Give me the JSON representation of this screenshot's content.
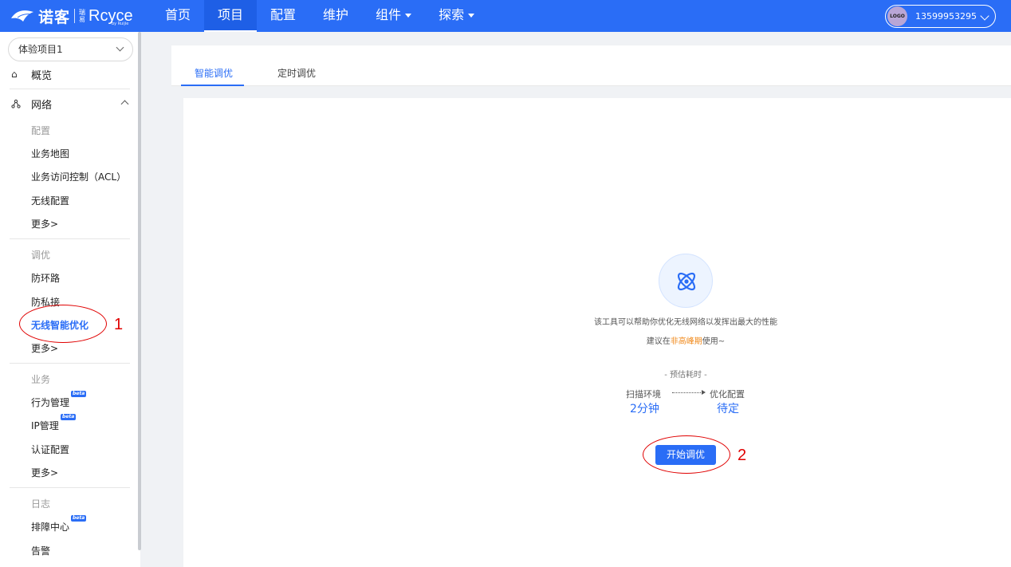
{
  "header": {
    "brand_cn": "诺客",
    "brand_sub": "瑞易",
    "brand_en": "Rcyce",
    "brand_tiny": "by Ruijie",
    "nav": [
      {
        "label": "首页",
        "active": false,
        "dropdown": false
      },
      {
        "label": "项目",
        "active": true,
        "dropdown": false
      },
      {
        "label": "配置",
        "active": false,
        "dropdown": false
      },
      {
        "label": "维护",
        "active": false,
        "dropdown": false
      },
      {
        "label": "组件",
        "active": false,
        "dropdown": true
      },
      {
        "label": "探索",
        "active": false,
        "dropdown": true
      }
    ],
    "user": {
      "logo_text": "LOGO",
      "phone": "13599953295"
    }
  },
  "sidebar": {
    "project": "体验项目1",
    "overview": "概览",
    "network": "网络",
    "groups": [
      {
        "title": "配置",
        "items": [
          "业务地图",
          "业务访问控制（ACL）",
          "无线配置",
          "更多>"
        ]
      },
      {
        "title": "调优",
        "items": [
          "防环路",
          "防私接",
          "无线智能优化",
          "更多>"
        ]
      },
      {
        "title": "业务",
        "items": [
          "行为管理",
          "IP管理",
          "认证配置",
          "更多>"
        ]
      },
      {
        "title": "日志",
        "items": [
          "排障中心",
          "告警"
        ]
      }
    ],
    "beta_label": "beta"
  },
  "tabs": [
    "智能调优",
    "定时调优"
  ],
  "main": {
    "desc_line1": "该工具可以帮助你优化无线网络以发挥出最大的性能",
    "desc_line2_pre": "建议在",
    "desc_line2_hl": "非高峰期",
    "desc_line2_post": "使用~",
    "estimate_title": "- 预估耗时 -",
    "step1_label": "扫描环境",
    "step1_value": "2分钟",
    "step2_label": "优化配置",
    "step2_value": "待定",
    "start_button": "开始调优"
  },
  "annotations": {
    "num1": "1",
    "num2": "2"
  },
  "colors": {
    "primary": "#2a6df6",
    "highlight": "#f08a1c",
    "annotation": "#e00000"
  }
}
